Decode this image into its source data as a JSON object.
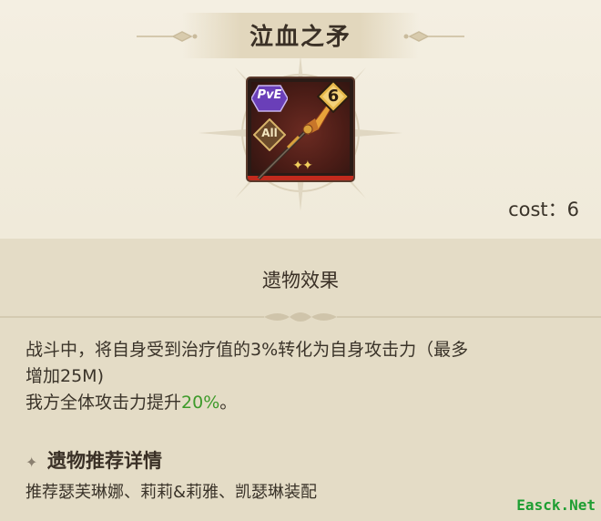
{
  "relic": {
    "name": "泣血之矛",
    "mode_badge": "PvE",
    "target_badge": "All",
    "level": "6",
    "stars": "✦✦",
    "cost_text": "cost：6"
  },
  "effect_section": {
    "title": "遗物效果",
    "line1": "战斗中，将自身受到治疗值的3%转化为自身攻击力（最多",
    "line2": "增加25M)",
    "line3_prefix": "我方全体攻击力提升",
    "line3_value": "20%",
    "line3_suffix": "。"
  },
  "recommend_section": {
    "title": "遗物推荐详情",
    "text": "推荐瑟芙琳娜、莉莉&莉雅、凯瑟琳装配"
  },
  "watermark": "Easck.Net",
  "colors": {
    "highlight_green": "#3d9a2a",
    "frame_red": "#c22a1d",
    "pve_purple": "#6a3fb8",
    "level_gold": "#e6b84a"
  },
  "icons": {
    "title_ornament": "winged-ornament-icon",
    "background": "compass-star-icon",
    "weapon": "spear-icon",
    "section_marker": "sparkle-icon"
  }
}
